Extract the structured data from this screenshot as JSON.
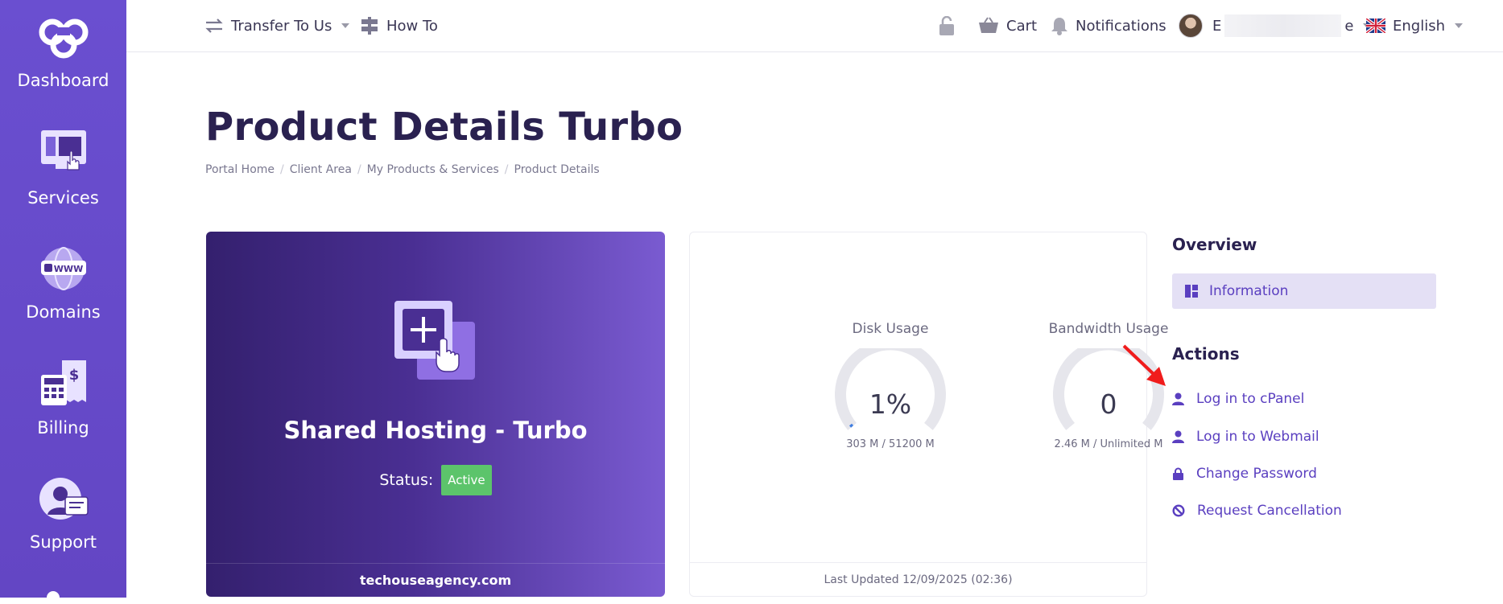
{
  "sidebar": {
    "items": [
      {
        "label": "Dashboard",
        "icon": "ccc-logo-icon"
      },
      {
        "label": "Services",
        "icon": "services-icon"
      },
      {
        "label": "Domains",
        "icon": "www-icon"
      },
      {
        "label": "Billing",
        "icon": "billing-icon"
      },
      {
        "label": "Support",
        "icon": "support-icon"
      }
    ]
  },
  "topbar": {
    "transfer": "Transfer To Us",
    "howto": "How To",
    "cart": "Cart",
    "notifications": "Notifications",
    "user_initial": "E",
    "user_tail": "e",
    "language": "English"
  },
  "page": {
    "title": "Product Details Turbo",
    "breadcrumb": [
      "Portal Home",
      "Client Area",
      "My Products & Services",
      "Product Details"
    ]
  },
  "product": {
    "name": "Shared Hosting - Turbo",
    "status_label": "Status:",
    "status": "Active",
    "domain": "techouseagency.com"
  },
  "usage": {
    "disk": {
      "title": "Disk Usage",
      "value": "1%",
      "detail": "303 M / 51200 M",
      "percent": 1
    },
    "bandwidth": {
      "title": "Bandwidth Usage",
      "value": "0",
      "detail": "2.46 M / Unlimited M",
      "percent": 0
    },
    "last_updated": "Last Updated 12/09/2025 (02:36)"
  },
  "panel": {
    "overview_title": "Overview",
    "info_label": "Information",
    "actions_title": "Actions",
    "actions": [
      "Log in to cPanel",
      "Log in to Webmail",
      "Change Password",
      "Request Cancellation"
    ]
  },
  "colors": {
    "accent": "#6a4fd0",
    "active": "#5cc46b",
    "link": "#5a3fc0"
  }
}
